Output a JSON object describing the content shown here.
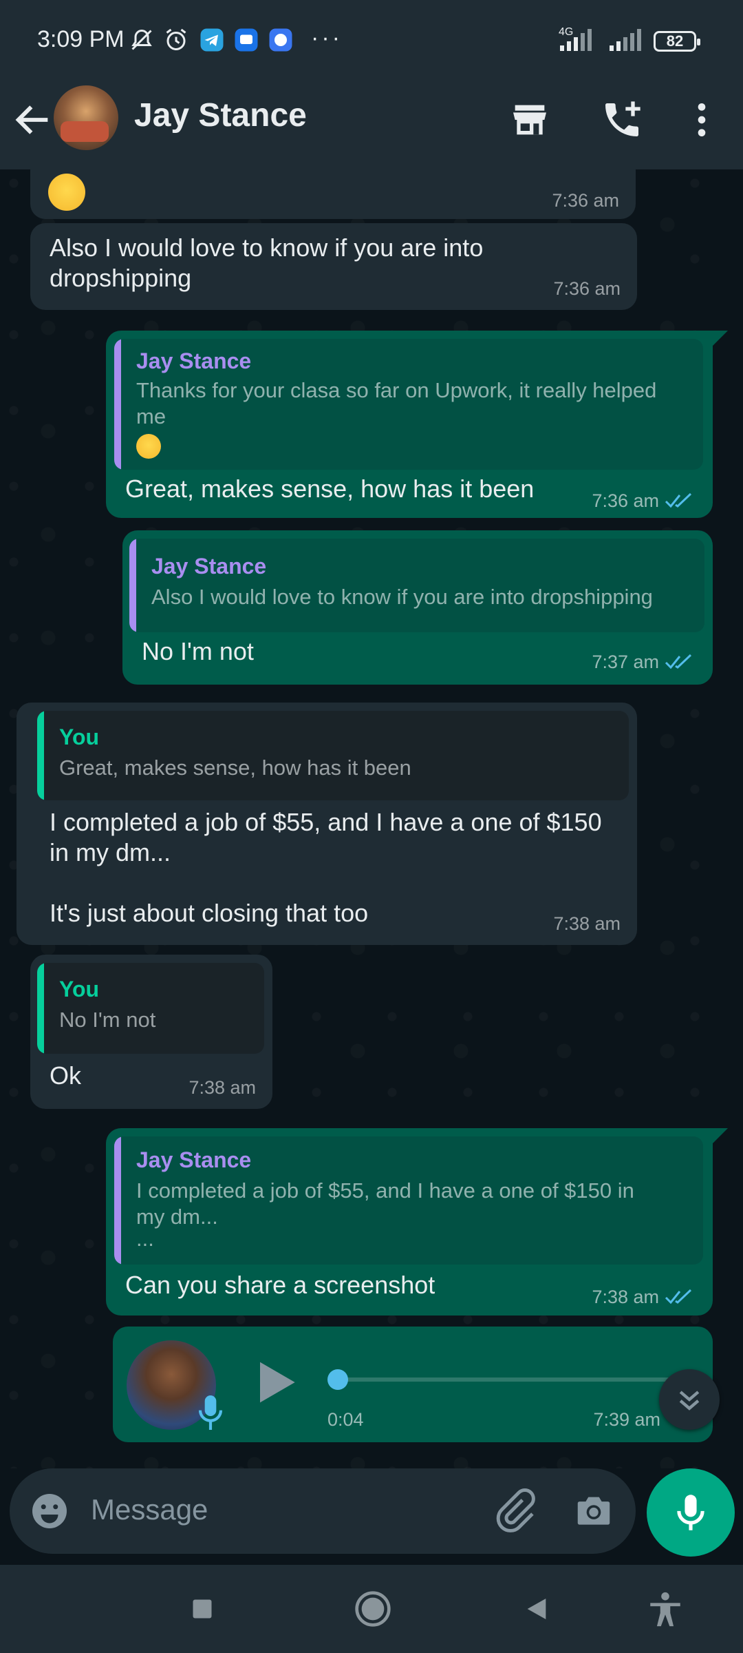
{
  "status_bar": {
    "time": "3:09 PM",
    "network": "4G",
    "battery": "82",
    "more": "···"
  },
  "header": {
    "contact_name": "Jay Stance"
  },
  "messages": [
    {
      "id": "m0",
      "time": "7:36 am"
    },
    {
      "id": "m1",
      "text": "Also I would love to know if you are into dropshipping",
      "line1": "Also I would love to know if you are into",
      "line2": "dropshipping",
      "time": "7:36 am"
    },
    {
      "id": "m2",
      "quote_name": "Jay Stance",
      "quote_line1": "Thanks for your clasa so far on Upwork, it really helped",
      "quote_line2": "me",
      "text": "Great, makes sense, how has it been",
      "time": "7:36 am"
    },
    {
      "id": "m3",
      "quote_name": "Jay Stance",
      "quote_line1": "Also I would love to know if you are into dropshipping",
      "text": "No I'm not",
      "time": "7:37 am"
    },
    {
      "id": "m4",
      "quote_name": "You",
      "quote_line1": "Great, makes sense, how has it been",
      "line1": "I completed a job of $55, and I have a one of $150",
      "line2": "in my dm...",
      "line3": "It's just about closing that too",
      "time": "7:38 am"
    },
    {
      "id": "m5",
      "quote_name": "You",
      "quote_line1": "No I'm not",
      "text": "Ok",
      "time": "7:38 am"
    },
    {
      "id": "m6",
      "quote_name": "Jay Stance",
      "quote_line1": "I completed a job of $55, and I have a one of $150 in",
      "quote_line2": "my dm...",
      "quote_line3": "...",
      "text": "Can you share a screenshot",
      "time": "7:38 am"
    },
    {
      "id": "m7",
      "voice_duration": "0:04",
      "time": "7:39 am",
      "progress": 0
    }
  ],
  "composer": {
    "placeholder": "Message"
  },
  "colors": {
    "incoming": "#1f2c34",
    "outgoing": "#005c4b",
    "accent": "#00a884",
    "quote_other": "#a98ef0",
    "quote_you": "#06cf9c",
    "read_ticks": "#53bdeb"
  }
}
